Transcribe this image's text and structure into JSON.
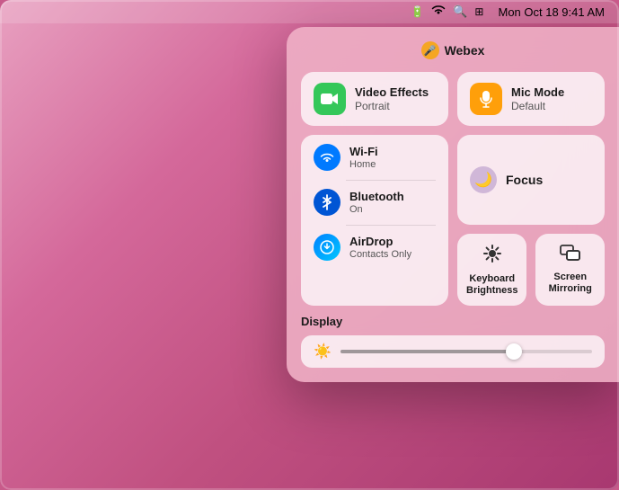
{
  "menubar": {
    "time": "Mon Oct 18  9:41 AM",
    "battery_icon": "🔋",
    "wifi_icon": "WiFi",
    "search_icon": "🔍",
    "control_icon": "⊞"
  },
  "webex": {
    "label": "Webex",
    "icon": "🎤"
  },
  "video_effects": {
    "title": "Video Effects",
    "subtitle": "Portrait",
    "icon_color": "#34c759"
  },
  "mic_mode": {
    "title": "Mic Mode",
    "subtitle": "Default",
    "icon_color": "#ff9f0a"
  },
  "wifi": {
    "title": "Wi-Fi",
    "subtitle": "Home"
  },
  "bluetooth": {
    "title": "Bluetooth",
    "subtitle": "On"
  },
  "airdrop": {
    "title": "AirDrop",
    "subtitle": "Contacts Only"
  },
  "focus": {
    "title": "Focus",
    "icon": "🌙"
  },
  "keyboard_brightness": {
    "title": "Keyboard",
    "subtitle": "Brightness"
  },
  "screen_mirroring": {
    "title": "Screen",
    "subtitle": "Mirroring"
  },
  "display": {
    "label": "Display",
    "slider_percent": 70
  }
}
